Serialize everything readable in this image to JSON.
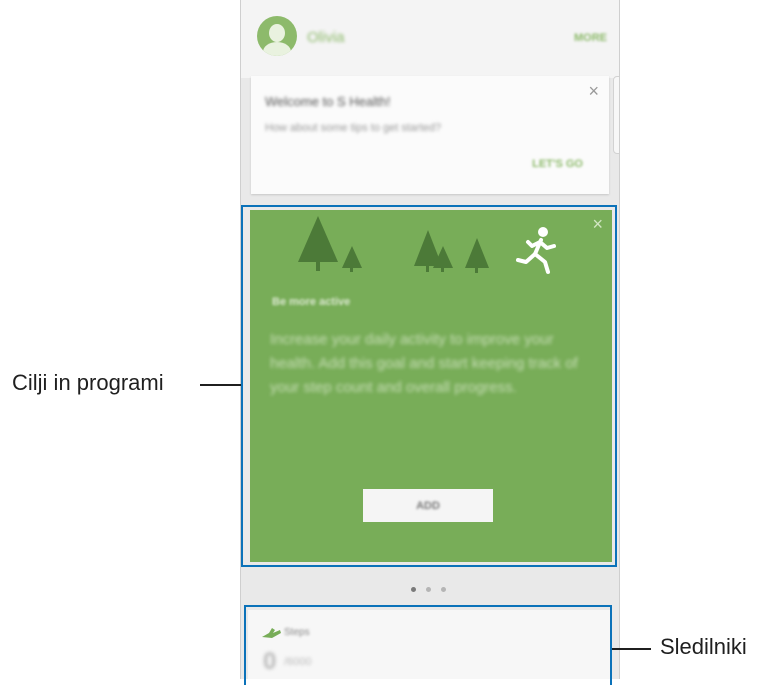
{
  "header": {
    "username": "Olivia",
    "more_label": "MORE"
  },
  "welcome_card": {
    "title": "Welcome to S Health!",
    "subtitle": "How about some tips to get started?",
    "cta_label": "LET'S GO",
    "close_glyph": "×"
  },
  "goal_card": {
    "heading": "Be more active",
    "description": "Increase your daily activity to improve your health. Add this goal and start keeping track of your step count and overall progress.",
    "add_label": "ADD",
    "close_glyph": "×",
    "illustration_icons": [
      "tree-icon",
      "tree-icon",
      "tree-icon",
      "tree-icon",
      "tree-icon",
      "running-person-icon"
    ]
  },
  "pager": {
    "count": 3,
    "active_index": 0
  },
  "steps_card": {
    "label": "Steps",
    "count": "0",
    "count_sub": "/6000",
    "icon": "shoe-icon"
  },
  "callouts": {
    "goals_label": "Cilji in programi",
    "trackers_label": "Sledilniki"
  },
  "colors": {
    "accent_green": "#8dba6b",
    "goal_card_green": "#78ad58",
    "highlight_blue": "#0b72b9",
    "background_gray": "#e9e9e9"
  }
}
